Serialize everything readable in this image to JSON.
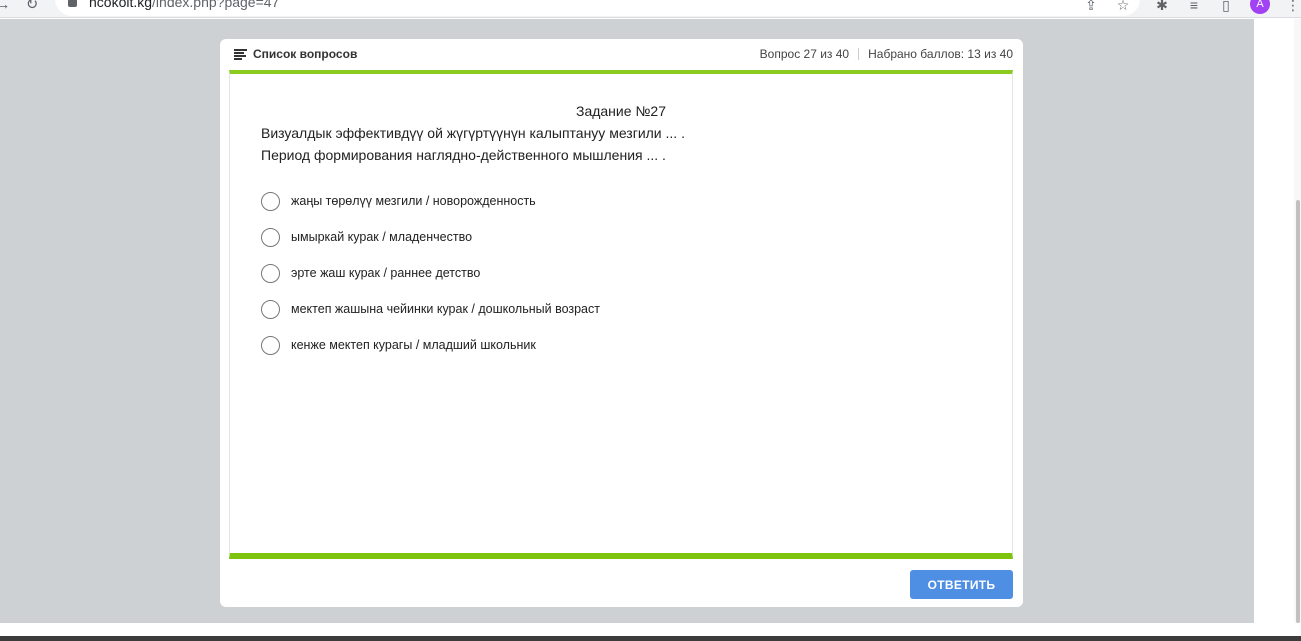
{
  "browser": {
    "url_host": "ncokoit.kg",
    "url_path": "/index.php?page=47",
    "avatar_letter": "A",
    "icons": [
      "forward-icon",
      "reload-icon",
      "lock-icon",
      "share-icon",
      "star-icon",
      "extensions-icon",
      "media-icon",
      "sidepanel-icon",
      "menu-icon"
    ]
  },
  "quiz": {
    "question_list_label": "Список вопросов",
    "question_counter": "Вопрос 27 из 40",
    "score_counter": "Набрано баллов: 13 из 40",
    "task_title": "Задание №27",
    "question_line_1": "Визуалдык эффективдүү ой жүгүртүүнүн калыптануу мезгили ... .",
    "question_line_2": "Период формирования наглядно-действенного мышления ... .",
    "options": [
      "жаңы төрөлүү мезгили / новорожденность",
      "ымыркай курак / младенчество",
      "эрте жаш курак / раннее детство",
      "мектеп жашына чейинки курак / дошкольный возраст",
      "кенже мектеп курагы / младший школьник"
    ],
    "submit_label": "ОТВЕТИТЬ"
  },
  "colors": {
    "accent_green": "#8ccc1f",
    "button_blue": "#4e8ee3",
    "page_background": "#cdd1d4"
  }
}
